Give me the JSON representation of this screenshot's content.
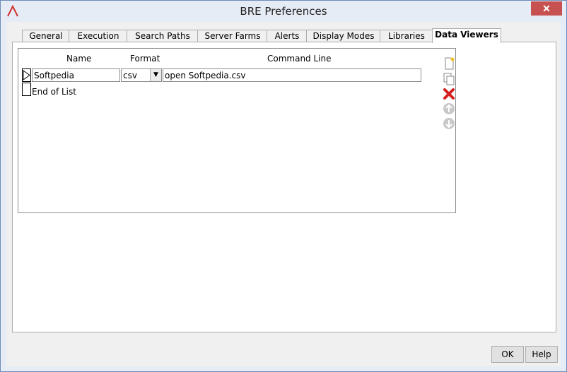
{
  "window": {
    "title": "BRE Preferences",
    "close_label": "✕"
  },
  "tabs": [
    {
      "label": "General"
    },
    {
      "label": "Execution"
    },
    {
      "label": "Search Paths"
    },
    {
      "label": "Server Farms"
    },
    {
      "label": "Alerts"
    },
    {
      "label": "Display Modes"
    },
    {
      "label": "Libraries"
    },
    {
      "label": "Data Viewers"
    }
  ],
  "active_tab": "Data Viewers",
  "grid": {
    "headers": {
      "name": "Name",
      "format": "Format",
      "command": "Command Line"
    },
    "rows": [
      {
        "name": "Softpedia",
        "format": "csv",
        "command": "open Softpedia.csv"
      }
    ],
    "end_text": "End of List"
  },
  "side_icons": [
    "new-item-icon",
    "copy-item-icon",
    "delete-item-icon",
    "move-up-icon",
    "move-down-icon"
  ],
  "buttons": {
    "ok": "OK",
    "help": "Help"
  },
  "colors": {
    "delete": "#d42020",
    "accent": "#c75050",
    "disabled": "#b0b0b0"
  }
}
